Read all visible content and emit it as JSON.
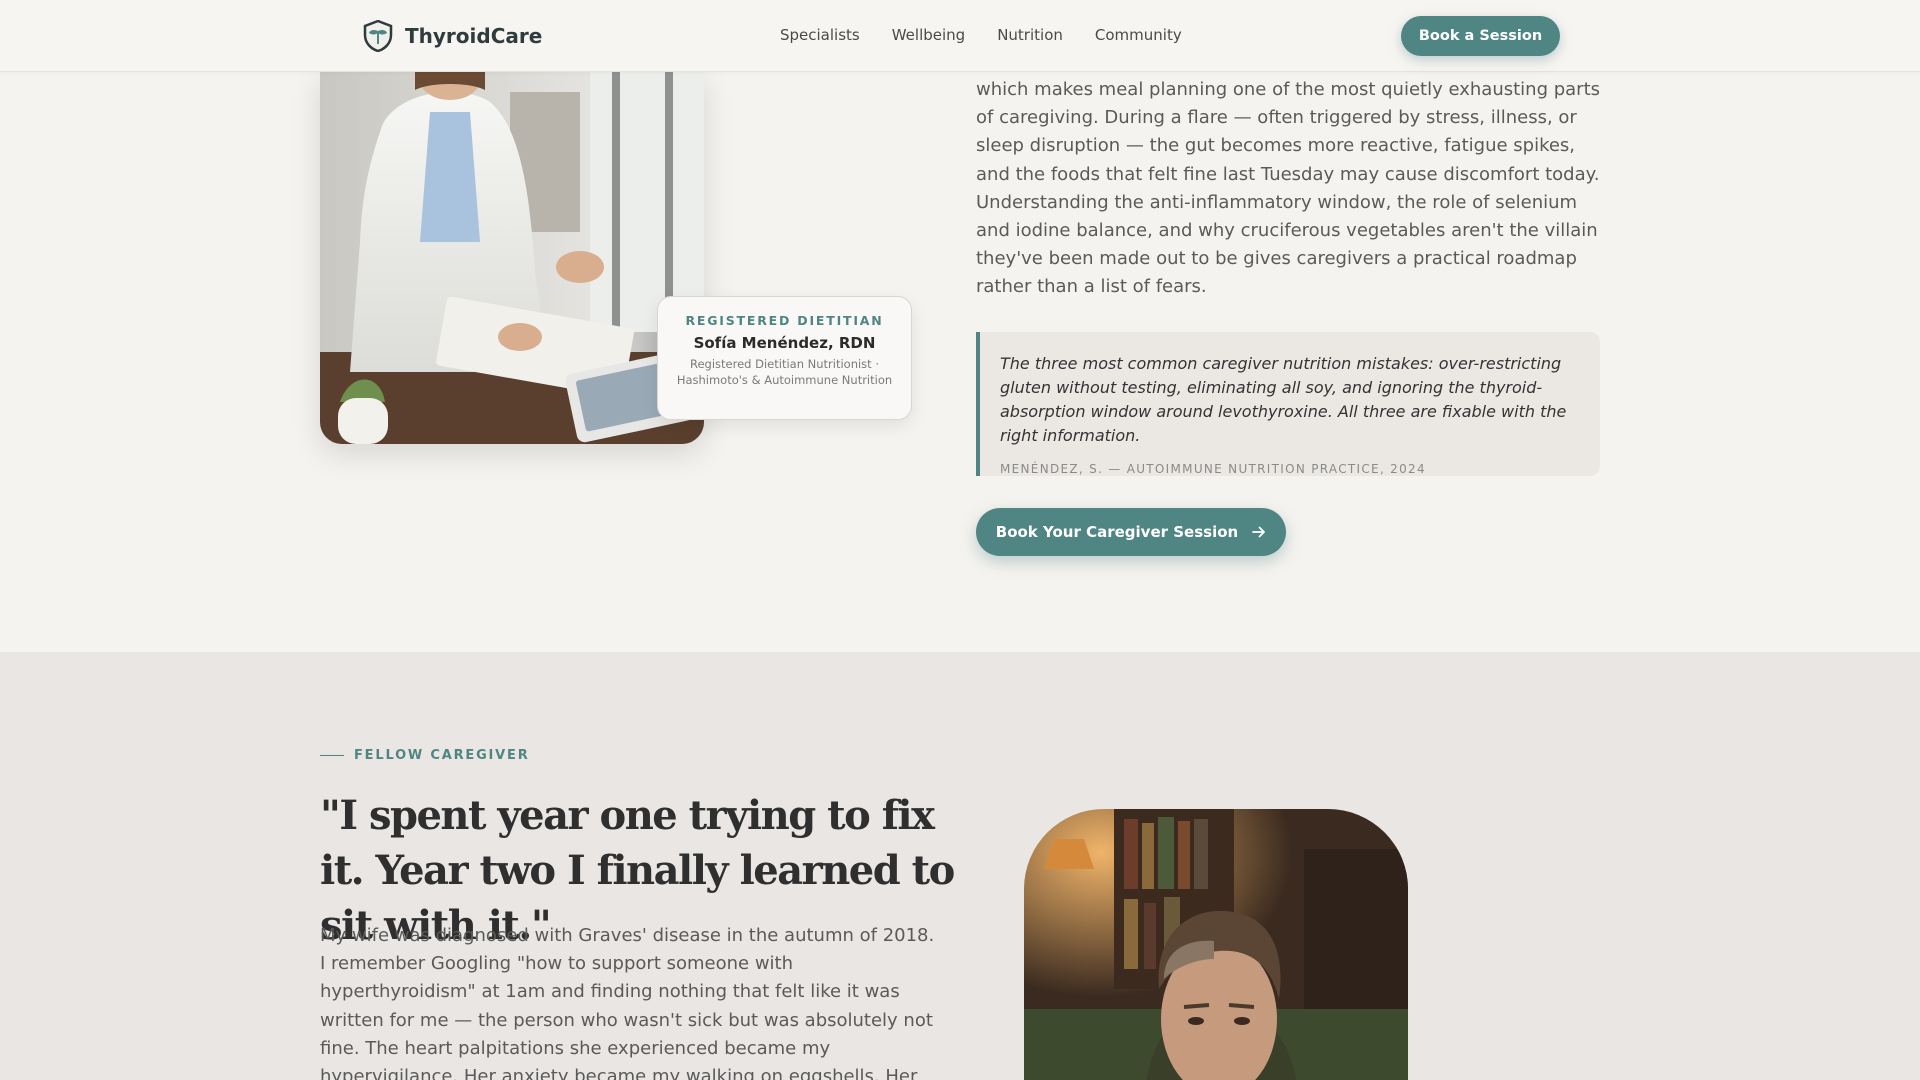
{
  "header": {
    "brand": "ThyroidCare",
    "nav": [
      "Specialists",
      "Wellbeing",
      "Nutrition",
      "Community"
    ],
    "cta": "Book a Session"
  },
  "dietitian_card": {
    "eyebrow": "REGISTERED DIETITIAN",
    "name": "Sofía Menéndez, RDN",
    "description": "Registered Dietitian Nutritionist · Hashimoto's & Autoimmune Nutrition"
  },
  "article": {
    "paragraph": "which makes meal planning one of the most quietly exhausting parts of caregiving. During a flare — often triggered by stress, illness, or sleep disruption — the gut becomes more reactive, fatigue spikes, and the foods that felt fine last Tuesday may cause discomfort today. Understanding the anti-inflammatory window, the role of selenium and iodine balance, and why cruciferous vegetables aren't the villain they've been made out to be gives caregivers a practical roadmap rather than a list of fears.",
    "quote": "The three most common caregiver nutrition mistakes: over-restricting gluten without testing, eliminating all soy, and ignoring the thyroid-absorption window around levothyroxine. All three are fixable with the right information.",
    "quote_cite": "MENÉNDEZ, S. — AUTOIMMUNE NUTRITION PRACTICE, 2024",
    "cta": "Book Your Caregiver Session"
  },
  "caregiver": {
    "eyebrow": "FELLOW CAREGIVER",
    "headline": "\"I spent year one trying to fix it. Year two I finally learned to sit with it.\"",
    "story": "My wife was diagnosed with Graves' disease in the autumn of 2018. I remember Googling \"how to support someone with hyperthyroidism\" at 1am and finding nothing that felt like it was written for me — the person who wasn't sick but was absolutely not fine. The heart palpitations she experienced became my hypervigilance. Her anxiety became my walking on eggshells. Her"
  },
  "icons": {
    "brand": "shield-leaf-icon",
    "cta_arrow": "arrow-right-icon"
  },
  "colors": {
    "accent": "#4f8583",
    "background": "#f5f3ef",
    "section_alt": "#e9e6e3"
  }
}
